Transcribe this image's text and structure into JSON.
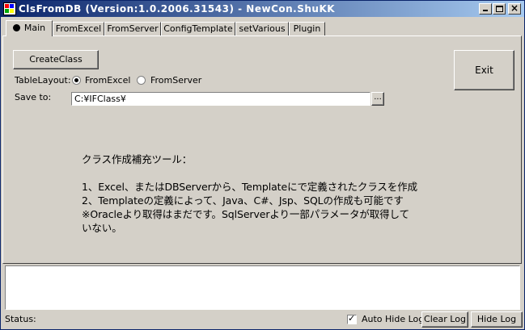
{
  "window": {
    "title": "ClsFromDB (Version:1.0.2006.31543) - NewCon.ShuKK",
    "minimize_icon": "minimize-icon",
    "maximize_icon": "maximize-icon",
    "close_icon": "close-icon",
    "close_glyph": "×"
  },
  "tabs": [
    {
      "label": "Main",
      "active": true
    },
    {
      "label": "FromExcel"
    },
    {
      "label": "FromServer"
    },
    {
      "label": "ConfigTemplate"
    },
    {
      "label": "setVarious"
    },
    {
      "label": "Plugin"
    }
  ],
  "main": {
    "create_class_label": "CreateClass",
    "exit_label": "Exit",
    "table_layout_label": "TableLayout:",
    "layout_options": [
      {
        "label": "FromExcel",
        "checked": true
      },
      {
        "label": "FromServer",
        "checked": false
      }
    ],
    "save_to_label": "Save to:",
    "save_to_value": "C:¥IFClass¥",
    "browse_label": "...",
    "description": [
      "クラス作成補充ツール：",
      "",
      "1、Excel、またはDBServerから、Templateにで定義されたクラスを作成",
      "2、Templateの定義によって、Java、C#、Jsp、SQLの作成も可能です",
      "※Oracleより取得はまだです。SqlServerより一部パラメータが取得して",
      "いない。"
    ]
  },
  "log": {
    "content": ""
  },
  "footer": {
    "status_label": "Status:",
    "auto_hide_label": "Auto Hide Log",
    "auto_hide_checked": true,
    "check_glyph": "✓",
    "clear_log_label": "Clear Log",
    "hide_log_label": "Hide Log"
  }
}
